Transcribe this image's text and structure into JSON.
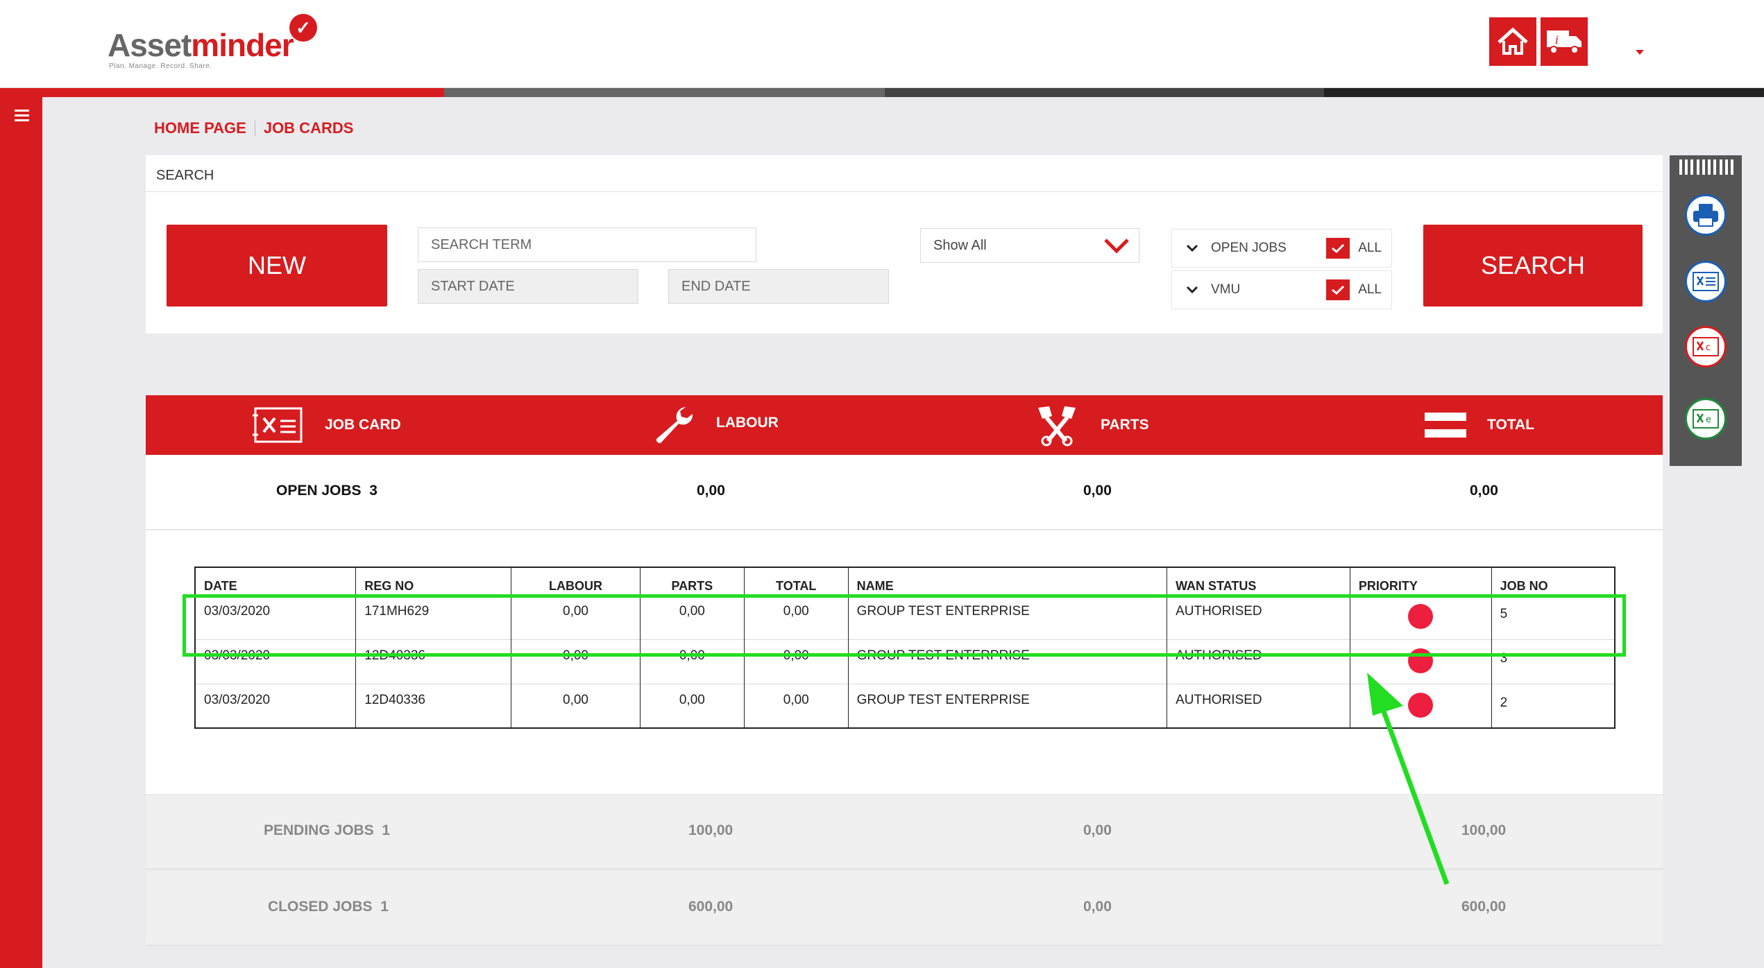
{
  "brand": {
    "name_part1": "Asset",
    "name_part2": "minder",
    "tagline": "Plan. Manage. Record. Share."
  },
  "header": {
    "home_icon": "home-icon",
    "info_truck_icon": "info-truck-icon"
  },
  "colors": {
    "accent": "#d61c1f",
    "priority_dot": "#ee1e3e",
    "annotation": "#22dd22",
    "toolbar": "#555555"
  },
  "breadcrumb": {
    "home": "HOME PAGE",
    "current": "JOB CARDS"
  },
  "search": {
    "title": "SEARCH",
    "new_label": "NEW",
    "term_placeholder": "SEARCH TERM",
    "start_date_placeholder": "START DATE",
    "end_date_placeholder": "END DATE",
    "show_select": "Show All",
    "filters": [
      {
        "label": "OPEN JOBS",
        "all": "ALL"
      },
      {
        "label": "VMU",
        "all": "ALL"
      }
    ],
    "search_label": "SEARCH"
  },
  "summary": {
    "columns": [
      "JOB CARD",
      "LABOUR",
      "PARTS",
      "TOTAL"
    ],
    "open": {
      "label": "OPEN JOBS",
      "count": "3",
      "labour": "0,00",
      "parts": "0,00",
      "total": "0,00"
    },
    "pending": {
      "label": "PENDING JOBS",
      "count": "1",
      "labour": "100,00",
      "parts": "0,00",
      "total": "100,00"
    },
    "closed": {
      "label": "CLOSED JOBS",
      "count": "1",
      "labour": "600,00",
      "parts": "0,00",
      "total": "600,00"
    }
  },
  "table": {
    "headers": [
      "DATE",
      "REG NO",
      "LABOUR",
      "PARTS",
      "TOTAL",
      "NAME",
      "WAN STATUS",
      "PRIORITY",
      "JOB NO"
    ],
    "rows": [
      {
        "date": "03/03/2020",
        "reg": "171MH629",
        "labour": "0,00",
        "parts": "0,00",
        "total": "0,00",
        "name": "GROUP TEST ENTERPRISE",
        "status": "AUTHORISED",
        "job": "5"
      },
      {
        "date": "03/03/2020",
        "reg": "12D40336",
        "labour": "0,00",
        "parts": "0,00",
        "total": "0,00",
        "name": "GROUP TEST ENTERPRISE",
        "status": "AUTHORISED",
        "job": "3"
      },
      {
        "date": "03/03/2020",
        "reg": "12D40336",
        "labour": "0,00",
        "parts": "0,00",
        "total": "0,00",
        "name": "GROUP TEST ENTERPRISE",
        "status": "AUTHORISED",
        "job": "2"
      }
    ]
  },
  "tools": [
    "barcode-icon",
    "print-icon",
    "export-pdf-icon",
    "export-csv-icon",
    "export-excel-icon"
  ]
}
